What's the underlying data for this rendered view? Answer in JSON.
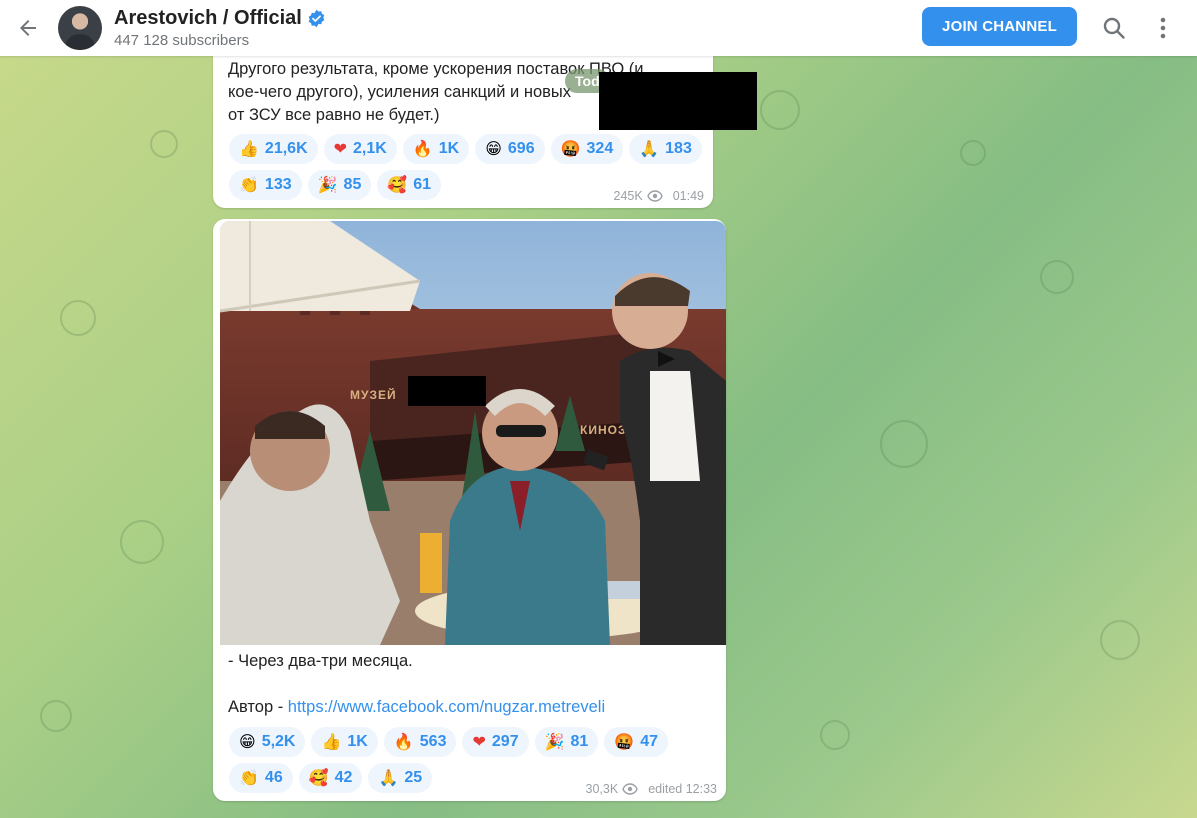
{
  "header": {
    "back_icon": "arrow-left-icon",
    "title": "Arestovich / Official",
    "verified_icon": "verified-badge-icon",
    "subscribers": "447 128 subscribers",
    "join_label": "JOIN CHANNEL",
    "search_icon": "search-icon",
    "more_icon": "more-vertical-icon"
  },
  "date_pill": "Tod",
  "messages": [
    {
      "text_lines": [
        "Другого результата, кроме ускорения поставок ПВО (и",
        "кое-чего другого), усиления санкций и новых",
        "от ЗСУ все равно не будет.)"
      ],
      "reactions": [
        {
          "emoji": "👍",
          "count": "21,6K"
        },
        {
          "emoji": "❤",
          "count": "2,1K"
        },
        {
          "emoji": "🔥",
          "count": "1K"
        },
        {
          "emoji": "😁",
          "count": "696"
        },
        {
          "emoji": "🤬",
          "count": "324"
        },
        {
          "emoji": "🙏",
          "count": "183"
        },
        {
          "emoji": "👏",
          "count": "133"
        },
        {
          "emoji": "🎉",
          "count": "85"
        },
        {
          "emoji": "🥰",
          "count": "61"
        }
      ],
      "views": "245K",
      "time": "01:49"
    },
    {
      "photo_signs": {
        "left": "МУЗЕЙ",
        "right": "КИНОЗАЛ"
      },
      "caption": "- Через два-три месяца.",
      "author_label": "Автор - ",
      "author_link": "https://www.facebook.com/nugzar.metreveli",
      "reactions": [
        {
          "emoji": "😁",
          "count": "5,2K"
        },
        {
          "emoji": "👍",
          "count": "1K"
        },
        {
          "emoji": "🔥",
          "count": "563"
        },
        {
          "emoji": "❤",
          "count": "297"
        },
        {
          "emoji": "🎉",
          "count": "81"
        },
        {
          "emoji": "🤬",
          "count": "47"
        },
        {
          "emoji": "👏",
          "count": "46"
        },
        {
          "emoji": "🥰",
          "count": "42"
        },
        {
          "emoji": "🙏",
          "count": "25"
        }
      ],
      "views": "30,3K",
      "time": "edited 12:33"
    }
  ],
  "colors": {
    "accent": "#3390ec",
    "reaction_bg": "#eef5fd"
  }
}
